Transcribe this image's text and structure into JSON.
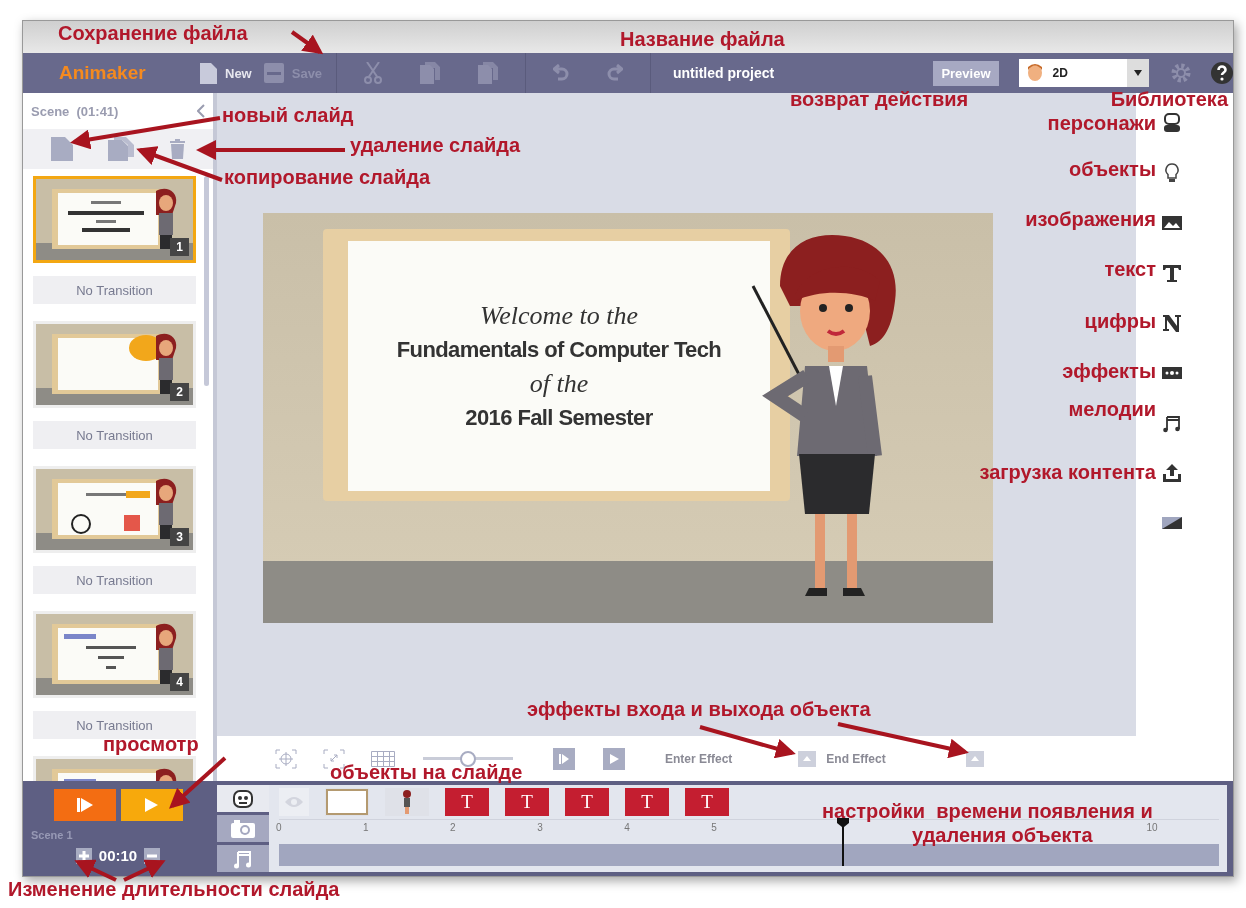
{
  "toolbar": {
    "logo": "Animaker",
    "file_buttons": [
      {
        "kind": "new",
        "label": "New",
        "disabled": false
      },
      {
        "kind": "save",
        "label": "Save",
        "disabled": true
      }
    ],
    "edit_tools": [
      {
        "kind": "cut"
      },
      {
        "kind": "copy"
      },
      {
        "kind": "paste"
      },
      {
        "kind": "undo"
      },
      {
        "kind": "redo"
      }
    ],
    "project_title": "untitled project",
    "preview": "Preview",
    "mode": "2D"
  },
  "scene_panel": {
    "title": "Scene  (01:41)",
    "slides": [
      {
        "number": "1",
        "selected": true,
        "kind": "welcome",
        "transition": "No Transition"
      },
      {
        "number": "2",
        "selected": false,
        "kind": "bubble",
        "transition": "No Transition"
      },
      {
        "number": "3",
        "selected": false,
        "kind": "clock",
        "transition": "No Transition"
      },
      {
        "number": "4",
        "selected": false,
        "kind": "lines",
        "transition": "No Transition"
      },
      {
        "selected": false,
        "kind": "lines"
      }
    ]
  },
  "stage": {
    "lines": [
      {
        "kind": "script",
        "text": "Welcome to the"
      },
      {
        "kind": "bold",
        "text": "Fundamentals of Computer Tech"
      },
      {
        "kind": "script",
        "text": "of the"
      },
      {
        "kind": "bold",
        "text": "2016 Fall Semester"
      }
    ]
  },
  "library": [
    {
      "kind": "character"
    },
    {
      "kind": "object"
    },
    {
      "kind": "image"
    },
    {
      "kind": "text"
    },
    {
      "kind": "number"
    },
    {
      "kind": "effect"
    },
    {
      "kind": "music"
    },
    {
      "kind": "upload"
    },
    {
      "kind": "background"
    }
  ],
  "stage_tools": {
    "zoom": {
      "level": 0.5
    },
    "enter_effect": "Enter Effect",
    "end_effect": "End Effect"
  },
  "timeline": {
    "play_buttons": [
      {
        "kind": "play-from"
      },
      {
        "kind": "play"
      }
    ],
    "scene": "Scene 1",
    "duration": "00:10",
    "tabs": [
      {
        "kind": "character",
        "selected": true
      },
      {
        "kind": "camera",
        "selected": false
      },
      {
        "kind": "music",
        "selected": false
      }
    ],
    "objects": [
      {
        "kind": "eye"
      },
      {
        "kind": "board"
      },
      {
        "kind": "character"
      },
      {
        "kind": "text",
        "label": "T"
      },
      {
        "kind": "text",
        "label": "T"
      },
      {
        "kind": "text",
        "label": "T"
      },
      {
        "kind": "text",
        "label": "T"
      },
      {
        "kind": "text",
        "label": "T"
      }
    ],
    "ticks": [
      "0",
      "1",
      "2",
      "3",
      "4",
      "5",
      "10"
    ],
    "playhead": {
      "level": 0.6
    }
  },
  "annotations": [
    "Сохранение файла",
    "Название файла",
    "новый слайд",
    "удаление слайда",
    "копирование слайда",
    "возврат действия",
    "Библиотека",
    "персонажи",
    "объекты",
    "изображения",
    "текст",
    "цифры",
    "эффекты",
    "мелодии",
    "загрузка контента",
    "эффекты входа и выхода объекта",
    "просмотр",
    "объекты на слайде",
    "настройки  времени появления и",
    "удаления объекта",
    "Изменение длительности слайда"
  ]
}
